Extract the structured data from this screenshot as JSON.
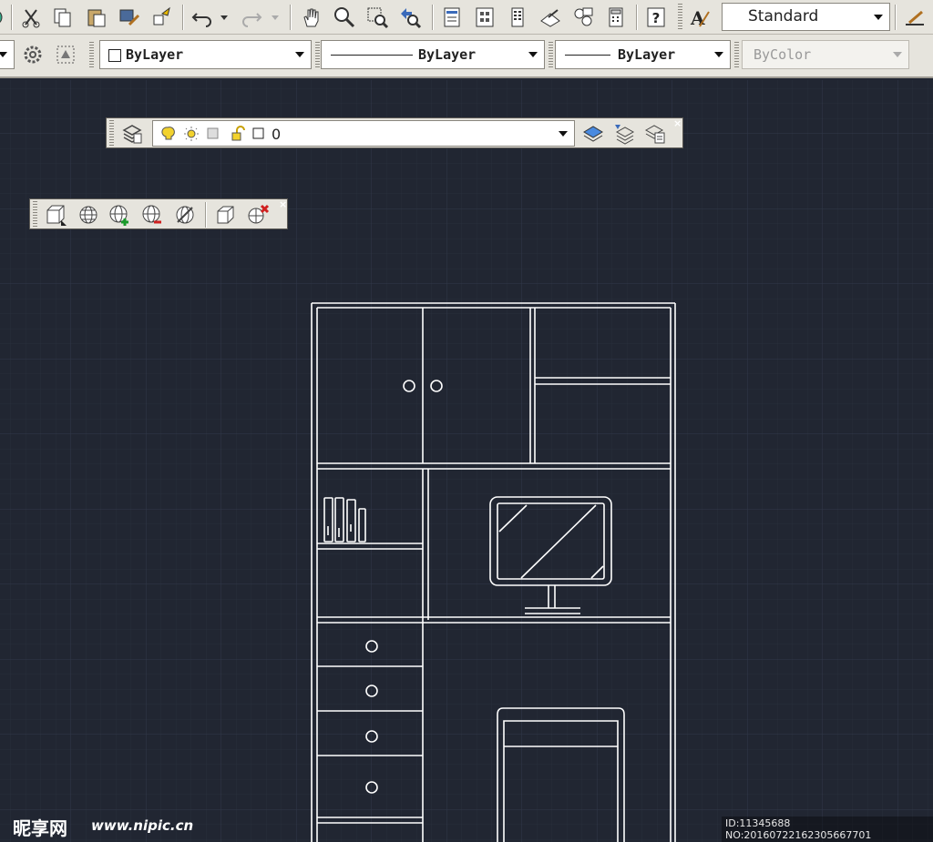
{
  "toolbar1": {
    "icons": [
      "pin-icon",
      "cut-icon",
      "copy-icon",
      "paste-icon",
      "match-properties-icon",
      "block-editor-icon",
      "undo-icon",
      "redo-icon",
      "pan-icon",
      "zoom-realtime-icon",
      "zoom-window-icon",
      "zoom-previous-icon",
      "properties-icon",
      "design-center-icon",
      "tool-palettes-icon",
      "markup-set-icon",
      "sheet-set-icon",
      "quickcalc-icon",
      "help-icon",
      "text-style-icon",
      "dimension-style-icon"
    ],
    "text_style_value": "Standard"
  },
  "toolbar2": {
    "color_value": "ByLayer",
    "linetype_value": "ByLayer",
    "lineweight_value": "ByLayer",
    "plotstyle_value": "ByColor"
  },
  "layers_toolbar": {
    "current_layer": "0",
    "close_label": "×"
  },
  "ucs_toolbar": {
    "close_label": "×"
  },
  "watermark": {
    "brand": "昵享网",
    "site": "www.nipic.cn",
    "id_text": "ID:11345688 NO:20160722162305667701"
  },
  "colors": {
    "canvas_bg": "#212632",
    "grid_minor": "#272d39",
    "grid_major": "#2f3644",
    "drawing_line": "#ffffff",
    "toolbar_bg": "#e6e4dd"
  }
}
